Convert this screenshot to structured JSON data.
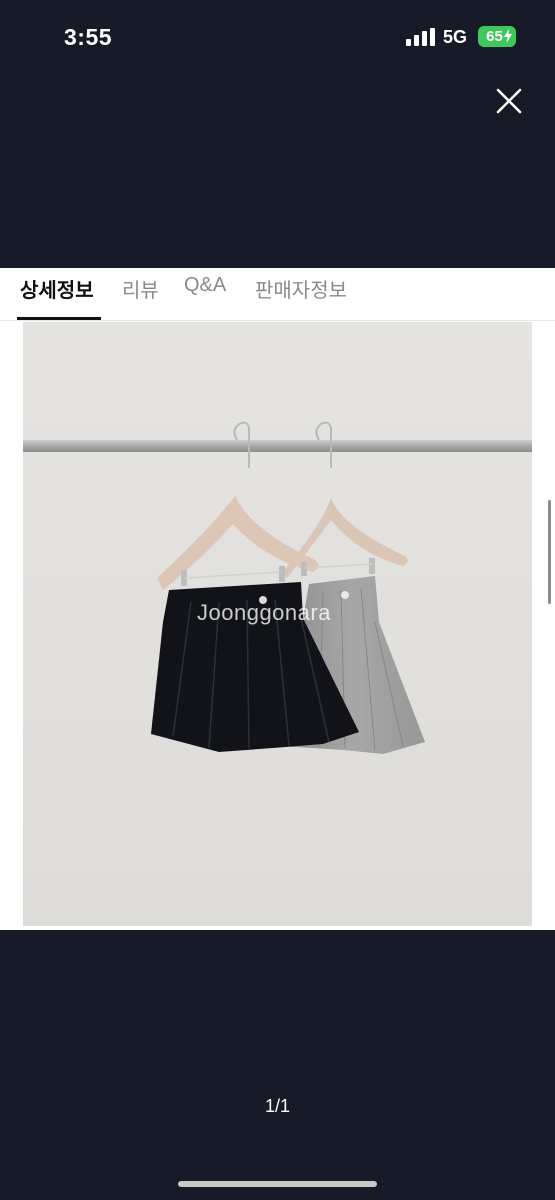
{
  "status": {
    "time": "3:55",
    "network": "5G",
    "battery": "65"
  },
  "tabs": [
    {
      "label": "상세정보",
      "active": true
    },
    {
      "label": "리뷰",
      "active": false
    },
    {
      "label": "Q&A",
      "active": false
    },
    {
      "label": "판매자정보",
      "active": false
    }
  ],
  "image": {
    "watermark": "Joonggonara"
  },
  "pager": {
    "text": "1/1"
  },
  "icons": {
    "close": "close-icon",
    "signal": "signal-icon",
    "battery": "battery-icon"
  },
  "colors": {
    "background": "#161b27",
    "battery": "#3ec85c",
    "active_tab": "#111111",
    "inactive_tab": "#8a8a8a"
  }
}
